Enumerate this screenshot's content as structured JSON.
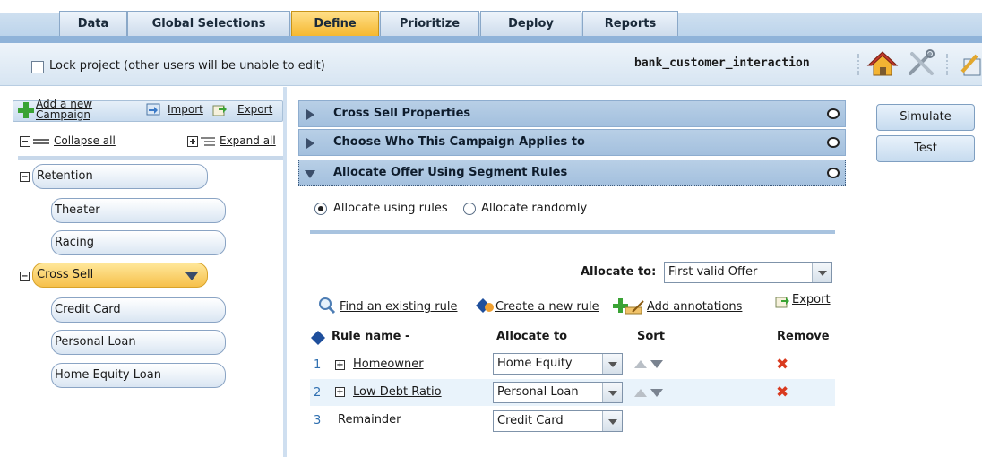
{
  "tabs": [
    {
      "label": "Data",
      "active": false
    },
    {
      "label": "Global Selections",
      "active": false
    },
    {
      "label": "Define",
      "active": true
    },
    {
      "label": "Prioritize",
      "active": false
    },
    {
      "label": "Deploy",
      "active": false
    },
    {
      "label": "Reports",
      "active": false
    }
  ],
  "project": {
    "lock_label": "Lock project (other users will be unable to edit)",
    "name": "bank_customer_interaction"
  },
  "left": {
    "add_label_line1": "Add a new",
    "add_label_line2": "Campaign",
    "import_label": "Import",
    "export_label": "Export",
    "collapse_label": "Collapse all",
    "expand_label": "Expand all",
    "tree": [
      {
        "label": "Retention",
        "children": [
          "Theater",
          "Racing"
        ]
      },
      {
        "label": "Cross Sell",
        "selected": true,
        "children": [
          "Credit Card",
          "Personal Loan",
          "Home Equity Loan"
        ]
      }
    ]
  },
  "accordion": [
    {
      "title": "Cross Sell Properties",
      "open": false
    },
    {
      "title": "Choose Who This Campaign Applies to",
      "open": false
    },
    {
      "title": "Allocate Offer Using Segment Rules",
      "open": true
    }
  ],
  "side_buttons": {
    "simulate": "Simulate",
    "test": "Test"
  },
  "allocation": {
    "option_rules": "Allocate using rules",
    "option_random": "Allocate randomly",
    "selected": "rules",
    "allocate_to_label": "Allocate to:",
    "allocate_to_value": "First valid Offer"
  },
  "actions": {
    "find": "Find an existing rule",
    "create": "Create a new rule",
    "annotations": "Add annotations",
    "export": "Export"
  },
  "table": {
    "headers": {
      "rule_name": "Rule name -",
      "allocate_to": "Allocate to",
      "sort": "Sort",
      "remove": "Remove"
    },
    "rows": [
      {
        "num": "1",
        "name": "Homeowner",
        "allocate": "Home Equity"
      },
      {
        "num": "2",
        "name": "Low Debt Ratio",
        "allocate": "Personal Loan"
      },
      {
        "num": "3",
        "name": "Remainder",
        "allocate": "Credit Card"
      }
    ]
  },
  "colors": {
    "active_tab": "#f5b830",
    "accordion": "#a3c0de",
    "remove": "#d93a1f",
    "link_number": "#2f6fb0"
  }
}
